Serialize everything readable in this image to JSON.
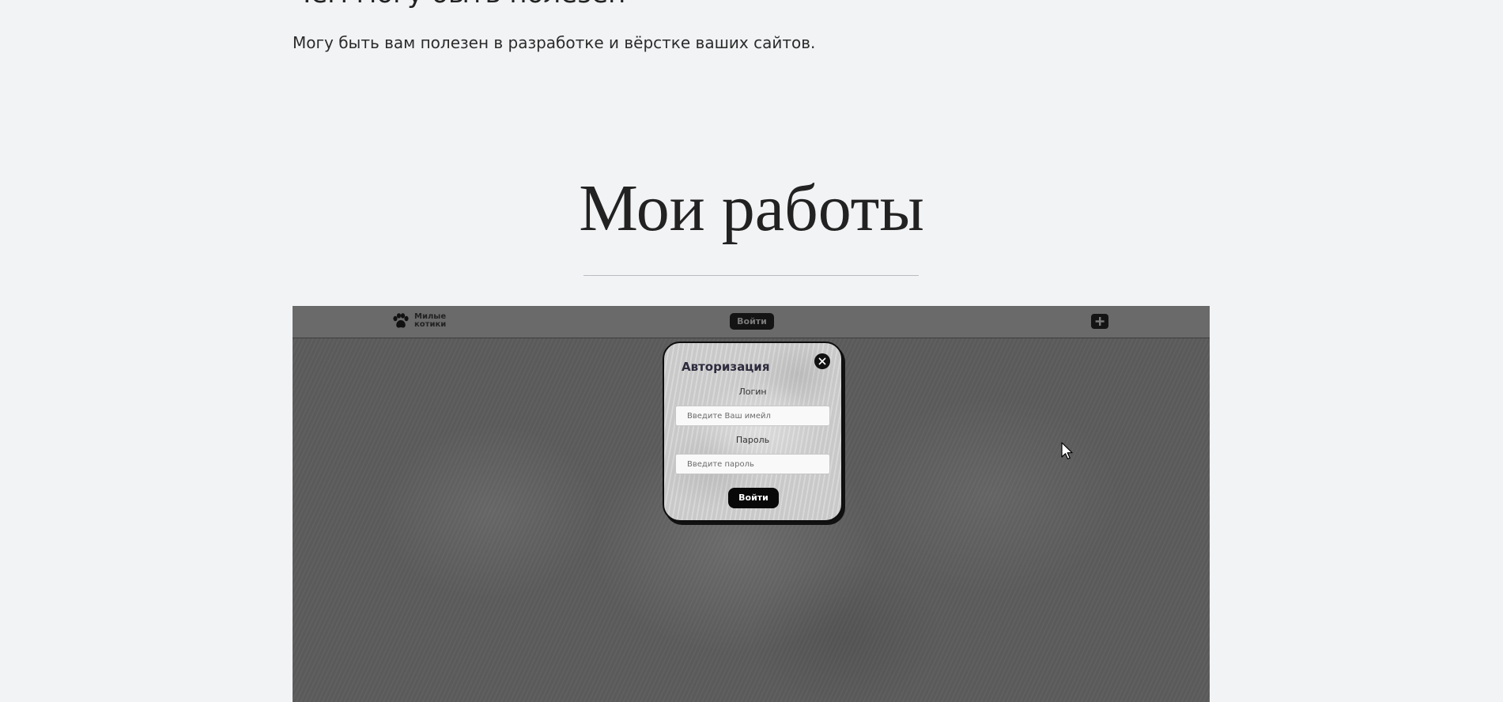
{
  "about": {
    "heading": "Чем могу быть полезен",
    "text": "Могу быть вам полезен в разработке и вёрстке ваших сайтов."
  },
  "works": {
    "title": "Мои работы"
  },
  "preview": {
    "logo_text": "Милые котики",
    "header_login_label": "Войти",
    "modal": {
      "title": "Авторизация",
      "login_label": "Логин",
      "email_placeholder": "Введите Ваш имейл",
      "password_label": "Пароль",
      "password_placeholder": "Введите пароль",
      "submit_label": "Войти"
    }
  },
  "icons": {
    "logo": "paw-icon",
    "add": "plus-icon",
    "close": "close-icon",
    "pointer": "mouse-cursor-icon"
  },
  "colors": {
    "page_background": "#f2f3f5",
    "preview_overlay": "#5d5d5d",
    "button_dark": "#141414",
    "modal_title": "#2d2b3d"
  }
}
